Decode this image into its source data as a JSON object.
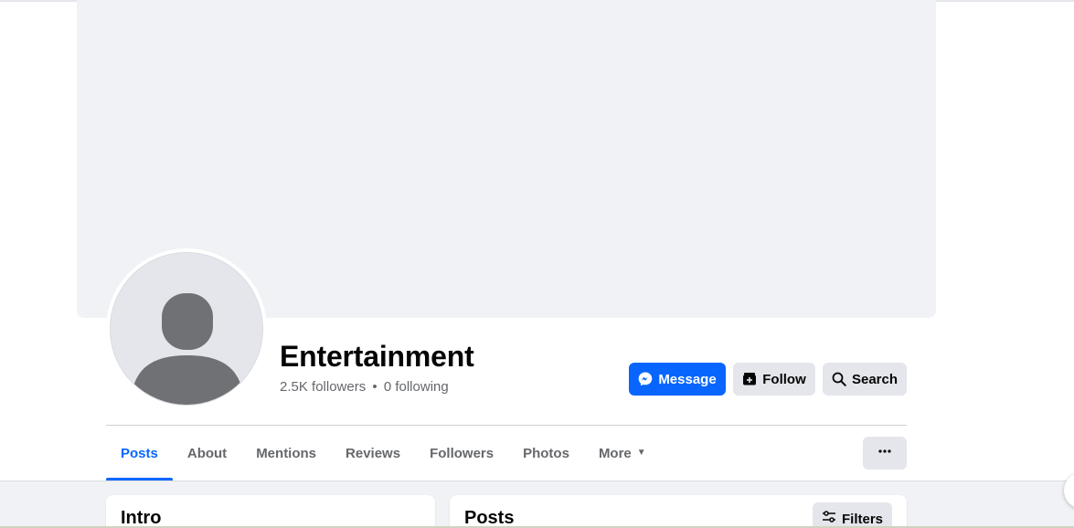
{
  "profile": {
    "name": "Entertainment",
    "followers": "2.5K followers",
    "separator": "•",
    "following": "0 following"
  },
  "actions": {
    "message_label": "Message",
    "follow_label": "Follow",
    "search_label": "Search"
  },
  "tabs": [
    {
      "label": "Posts",
      "active": true
    },
    {
      "label": "About"
    },
    {
      "label": "Mentions"
    },
    {
      "label": "Reviews"
    },
    {
      "label": "Followers"
    },
    {
      "label": "Photos"
    },
    {
      "label": "More"
    }
  ],
  "cards": {
    "intro_title": "Intro",
    "posts_title": "Posts",
    "filters_label": "Filters"
  },
  "icons": {
    "message": "messenger-icon",
    "follow": "follow-icon",
    "search": "search-icon",
    "more_options": "ellipsis-icon",
    "filters": "sliders-icon",
    "more_caret": "caret-down-icon"
  },
  "colors": {
    "accent": "#0866ff",
    "secondary_button": "#e4e6eb",
    "cover": "#f0f2f5",
    "muted_text": "#65676b"
  }
}
